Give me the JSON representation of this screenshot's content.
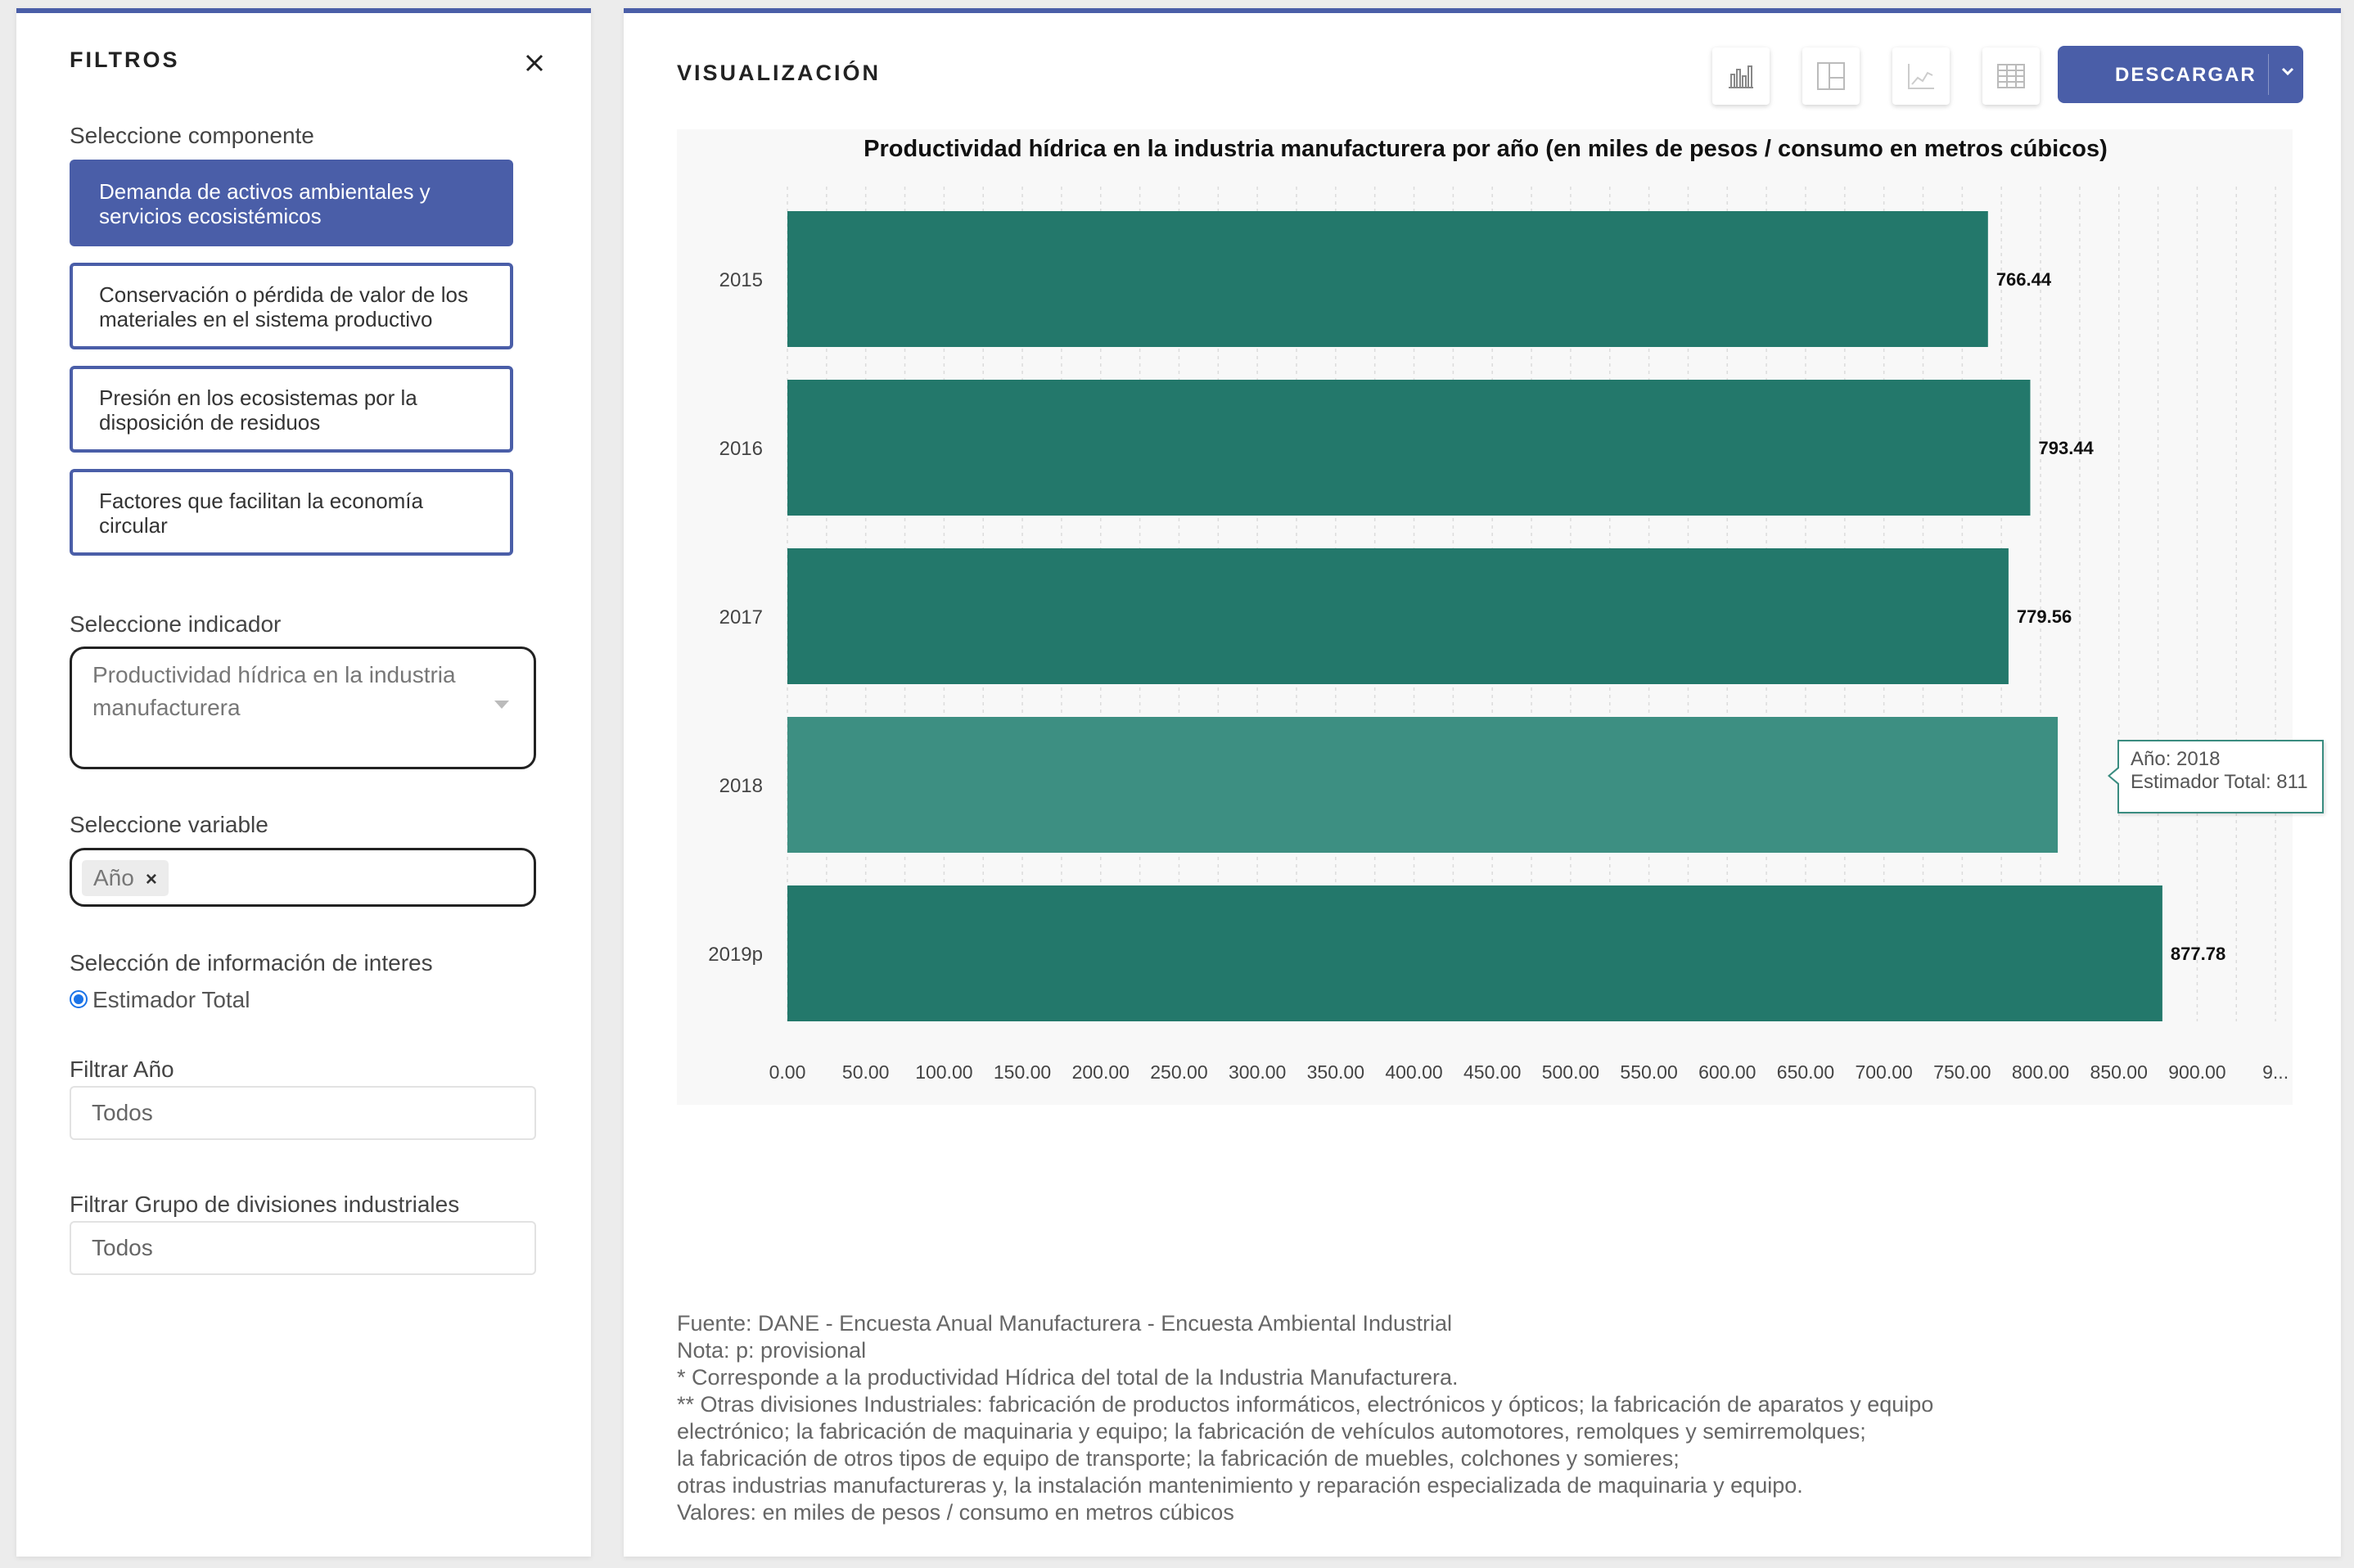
{
  "filters": {
    "title": "FILTROS",
    "component_label": "Seleccione componente",
    "components": [
      "Demanda de activos ambientales y servicios ecosistémicos",
      "Conservación o pérdida de valor de los materiales en el sistema productivo",
      "Presión en los ecosistemas por la disposición de residuos",
      "Factores que facilitan la economía circular"
    ],
    "active_component": 0,
    "indicator_label": "Seleccione indicador",
    "indicator_value": "Productividad hídrica en la industria manufacturera",
    "variable_label": "Seleccione variable",
    "variable_tag": "Año",
    "variable_tag_remove": "×",
    "info_label": "Selección de información de interes",
    "info_option": "Estimador Total",
    "year_filter_label": "Filtrar Año",
    "year_filter_value": "Todos",
    "group_filter_label": "Filtrar Grupo de divisiones industriales",
    "group_filter_value": "Todos"
  },
  "visualization": {
    "title": "VISUALIZACIÓN",
    "toolbar_icons": [
      "bar-chart-icon",
      "treemap-icon",
      "line-chart-icon",
      "table-icon"
    ],
    "download_label": "DESCARGAR",
    "tooltip": {
      "line1": "Año: 2018",
      "line2": "Estimador Total: 811"
    },
    "notes": [
      "Fuente: DANE - Encuesta Anual Manufacturera - Encuesta Ambiental Industrial",
      "Nota: p: provisional",
      "* Corresponde a la productividad Hídrica del total de la Industria Manufacturera.",
      "** Otras divisiones Industriales: fabricación de productos informáticos, electrónicos y ópticos; la fabricación de aparatos y equipo",
      "electrónico; la fabricación de maquinaria y equipo; la fabricación de vehículos automotores, remolques y semirremolques;",
      "la fabricación de otros tipos de equipo de transporte; la fabricación de muebles, colchones y somieres;",
      "otras industrias manufactureras y, la instalación mantenimiento y reparación especializada de maquinaria y equipo.",
      "Valores: en miles de pesos / consumo en metros cúbicos"
    ]
  },
  "chart_data": {
    "type": "bar",
    "orientation": "horizontal",
    "title": "Productividad hídrica en la industria manufacturera por año (en miles de pesos / consumo en metros cúbicos)",
    "categories": [
      "2015",
      "2016",
      "2017",
      "2018",
      "2019p"
    ],
    "values": [
      766.44,
      793.44,
      779.56,
      811,
      877.78
    ],
    "value_labels": [
      "766.44",
      "793.44",
      "779.56",
      "",
      "877.78"
    ],
    "xticks": [
      "0.00",
      "50.00",
      "100.00",
      "150.00",
      "200.00",
      "250.00",
      "300.00",
      "350.00",
      "400.00",
      "450.00",
      "500.00",
      "550.00",
      "600.00",
      "650.00",
      "700.00",
      "750.00",
      "800.00",
      "850.00",
      "900.00",
      "9..."
    ],
    "xlim": [
      0,
      950
    ],
    "highlighted_category": "2018",
    "colors": {
      "bar": "#23786b",
      "bar_highlight": "#3d8f82"
    },
    "grid": true
  }
}
